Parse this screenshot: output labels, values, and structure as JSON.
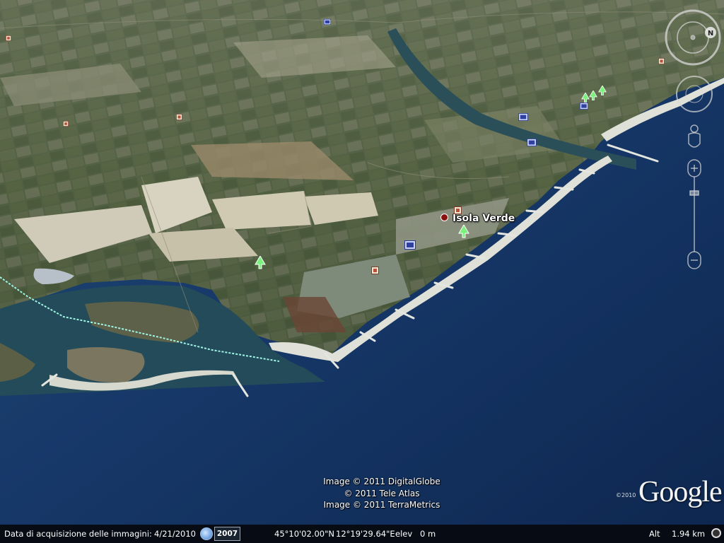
{
  "map": {
    "place_label": "Isola Verde",
    "colors": {
      "sea_deep": "#112e5c",
      "sea_shallow": "#1f4f6a",
      "land": "#4b5a3f",
      "beach": "#d9dcd2",
      "track": "#9ff5e4"
    }
  },
  "credits": {
    "line1": "Image © 2011 DigitalGlobe",
    "line2": "© 2011 Tele Atlas",
    "line3": "Image © 2011 TerraMetrics"
  },
  "logo": {
    "text": "Google",
    "year": "©2010"
  },
  "navigation": {
    "look_icon": "compass-ring-icon",
    "north_label": "N",
    "move_icon": "move-joystick-icon",
    "pegman_icon": "street-view-pegman-icon",
    "zoom_icon": "zoom-slider-icon"
  },
  "status": {
    "imagery_date_label": "Data di acquisizione delle immagini:",
    "imagery_date": "4/21/2010",
    "history_year": "2007",
    "latitude": "45°10'02.00\"N",
    "longitude": "12°19'29.64\"E",
    "elev_label": "elev",
    "elev_value": "0 m",
    "alt_label": "Alt",
    "alt_value": "1.94 km"
  }
}
